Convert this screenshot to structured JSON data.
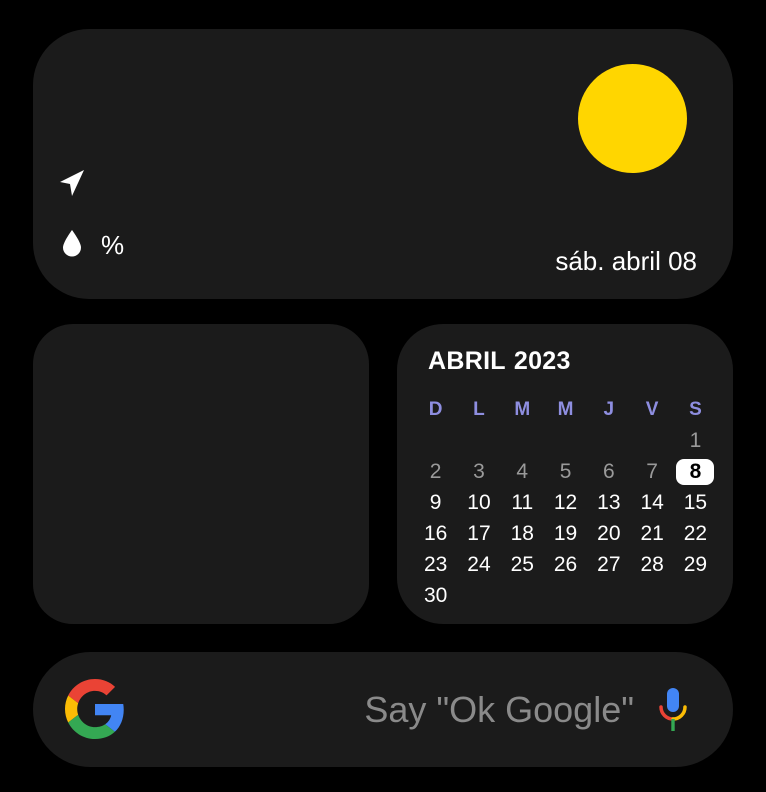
{
  "weather": {
    "humidity_text": "%",
    "date": "sáb. abril 08",
    "icons": [
      "navigation-arrow-icon",
      "water-drop-icon",
      "sun-icon"
    ],
    "sun_color": "#FFD600"
  },
  "calendar": {
    "month": "ABRIL",
    "year": "2023",
    "weekdays": [
      "D",
      "L",
      "M",
      "M",
      "J",
      "V",
      "S"
    ],
    "leading_blanks": 6,
    "days": [
      1,
      2,
      3,
      4,
      5,
      6,
      7,
      8,
      9,
      10,
      11,
      12,
      13,
      14,
      15,
      16,
      17,
      18,
      19,
      20,
      21,
      22,
      23,
      24,
      25,
      26,
      27,
      28,
      29,
      30
    ],
    "today": 8,
    "weekday_color": "#8e8ee0"
  },
  "search": {
    "hint": "Say \"Ok Google\"",
    "icons": [
      "google-logo-icon",
      "microphone-icon"
    ]
  }
}
